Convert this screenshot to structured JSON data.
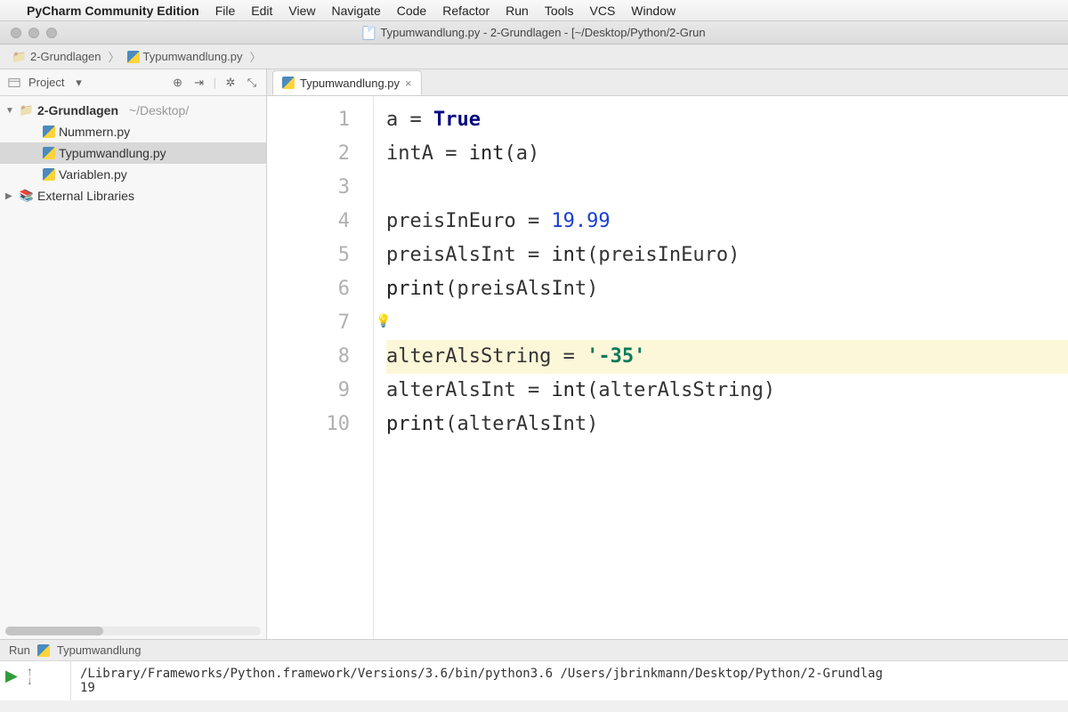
{
  "menubar": {
    "app": "PyCharm Community Edition",
    "items": [
      "File",
      "Edit",
      "View",
      "Navigate",
      "Code",
      "Refactor",
      "Run",
      "Tools",
      "VCS",
      "Window"
    ]
  },
  "window": {
    "title": "Typumwandlung.py - 2-Grundlagen - [~/Desktop/Python/2-Grun"
  },
  "breadcrumb": {
    "folder": "2-Grundlagen",
    "file": "Typumwandlung.py"
  },
  "sidebar": {
    "title": "Project",
    "root": {
      "name": "2-Grundlagen",
      "path": "~/Desktop/"
    },
    "files": [
      "Nummern.py",
      "Typumwandlung.py",
      "Variablen.py"
    ],
    "selected": "Typumwandlung.py",
    "external": "External Libraries"
  },
  "editor": {
    "tab": "Typumwandlung.py",
    "current_line": 8,
    "lines": [
      {
        "n": 1,
        "tokens": [
          [
            "a = ",
            "p"
          ],
          [
            "True",
            "kw"
          ]
        ]
      },
      {
        "n": 2,
        "tokens": [
          [
            "intA = ",
            "p"
          ],
          [
            "int",
            "bi"
          ],
          [
            "(a)",
            "p"
          ]
        ]
      },
      {
        "n": 3,
        "tokens": [
          [
            "",
            "p"
          ]
        ]
      },
      {
        "n": 4,
        "tokens": [
          [
            "preisInEuro = ",
            "p"
          ],
          [
            "19.99",
            "num"
          ]
        ]
      },
      {
        "n": 5,
        "tokens": [
          [
            "preisAlsInt = ",
            "p"
          ],
          [
            "int",
            "bi"
          ],
          [
            "(preisInEuro)",
            "p"
          ]
        ]
      },
      {
        "n": 6,
        "tokens": [
          [
            "print",
            "bi"
          ],
          [
            "(preisAlsInt)",
            "p"
          ]
        ]
      },
      {
        "n": 7,
        "tokens": [
          [
            "",
            "p"
          ]
        ]
      },
      {
        "n": 8,
        "tokens": [
          [
            "alterAlsString = ",
            "p"
          ],
          [
            "'-35'",
            "str"
          ]
        ]
      },
      {
        "n": 9,
        "tokens": [
          [
            "alterAlsInt = ",
            "p"
          ],
          [
            "int",
            "bi"
          ],
          [
            "(alterAlsString)",
            "p"
          ]
        ]
      },
      {
        "n": 10,
        "tokens": [
          [
            "print",
            "bi"
          ],
          [
            "(alterAlsInt)",
            "p"
          ]
        ]
      }
    ]
  },
  "run": {
    "label": "Run",
    "config": "Typumwandlung",
    "command": "/Library/Frameworks/Python.framework/Versions/3.6/bin/python3.6 /Users/jbrinkmann/Desktop/Python/2-Grundlag",
    "output": "19"
  }
}
